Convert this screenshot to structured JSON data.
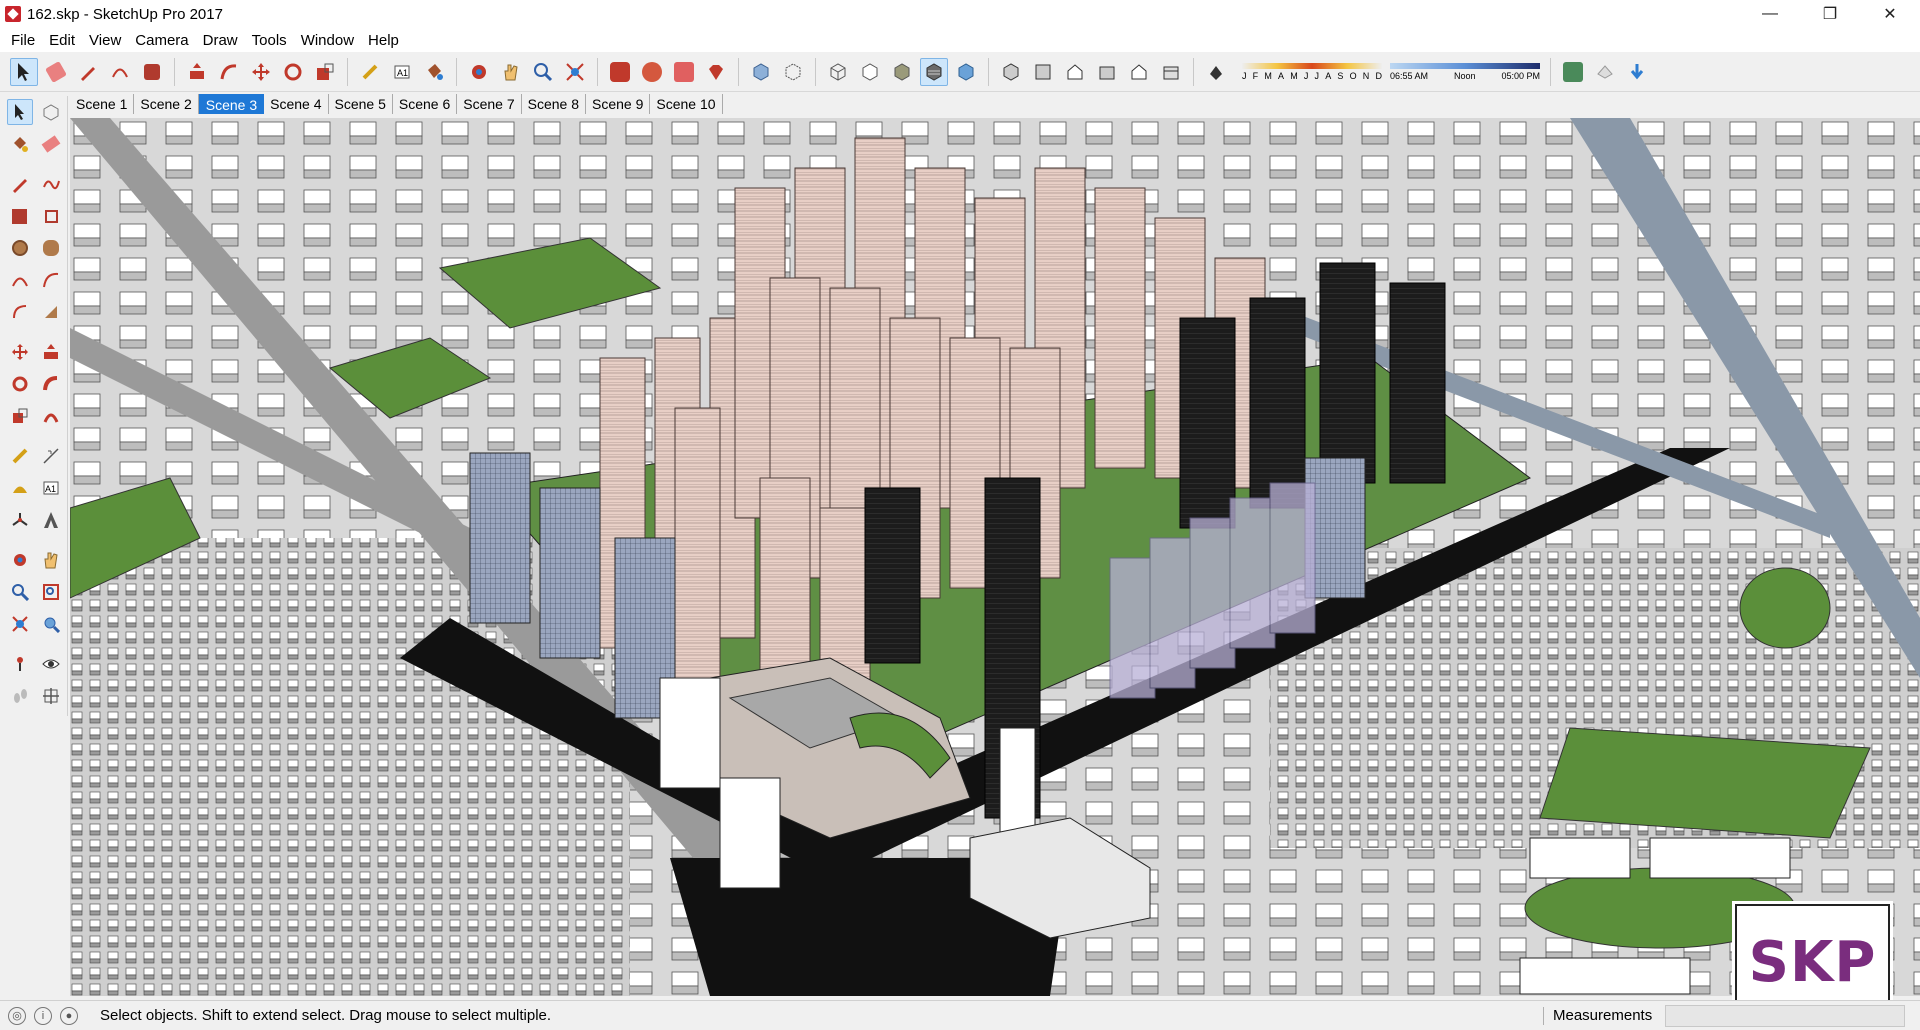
{
  "window": {
    "title": "162.skp - SketchUp Pro 2017",
    "minimize": "—",
    "maximize": "❐",
    "close": "✕"
  },
  "menu": [
    "File",
    "Edit",
    "View",
    "Camera",
    "Draw",
    "Tools",
    "Window",
    "Help"
  ],
  "scenes": {
    "tabs": [
      "Scene 1",
      "Scene 2",
      "Scene 3",
      "Scene 4",
      "Scene 5",
      "Scene 6",
      "Scene 7",
      "Scene 8",
      "Scene 9",
      "Scene 10"
    ],
    "active": "Scene 3"
  },
  "shadows": {
    "months": [
      "J",
      "F",
      "M",
      "A",
      "M",
      "J",
      "J",
      "A",
      "S",
      "O",
      "N",
      "D"
    ],
    "time_start": "06:55 AM",
    "time_mid": "Noon",
    "time_end": "05:00 PM"
  },
  "status": {
    "hint": "Select objects. Shift to extend select. Drag mouse to select multiple.",
    "measurements_label": "Measurements",
    "measurements_value": ""
  },
  "logo": {
    "text": "SKP"
  },
  "colors": {
    "accent": "#1e78d6",
    "grass": "#5b8f3a",
    "tower_pink": "#e8cfc6",
    "tower_dark": "#1c1c1c",
    "glass": "#b8b0d6",
    "logo": "#7a2d7e"
  },
  "icons": {
    "main_toolbar": [
      "select-icon",
      "eraser-icon",
      "pencil-icon",
      "lasso-icon",
      "paint-icon",
      "push-pull-icon",
      "follow-me-icon",
      "move-icon",
      "rotate-icon",
      "scale-icon",
      "tape-icon",
      "text-icon",
      "paint-bucket-icon",
      "orbit-icon",
      "pan-icon",
      "zoom-icon",
      "zoom-extents-icon",
      "warehouse-icon",
      "extension-icon",
      "ruby-icon",
      "xray-icon",
      "back-edges-icon",
      "wireframe-icon",
      "hidden-line-icon",
      "shaded-icon",
      "shaded-texture-icon",
      "monochrome-icon",
      "iso-icon",
      "top-icon",
      "front-icon",
      "right-icon",
      "back-icon",
      "left-icon",
      "shadow-toggle-icon",
      "geo-icon",
      "fog-icon",
      "export-icon"
    ]
  }
}
